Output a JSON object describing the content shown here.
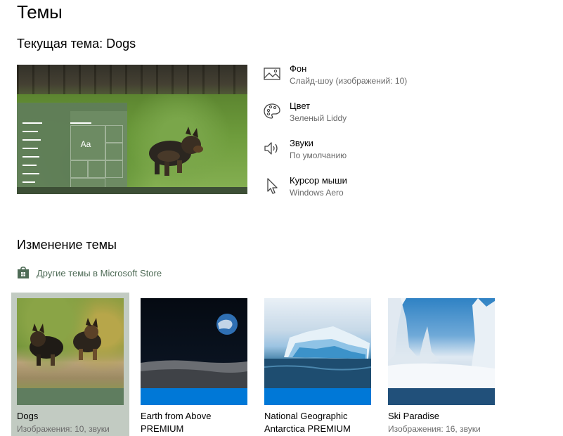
{
  "page": {
    "title": "Темы",
    "current_theme_label": "Текущая тема: Dogs"
  },
  "preview": {
    "sample_text": "Aa"
  },
  "properties": [
    {
      "title": "Фон",
      "subtitle": "Слайд-шоу (изображений: 10)",
      "icon": "picture-icon"
    },
    {
      "title": "Цвет",
      "subtitle": "Зеленый Liddy",
      "icon": "palette-icon"
    },
    {
      "title": "Звуки",
      "subtitle": "По умолчанию",
      "icon": "speaker-icon"
    },
    {
      "title": "Курсор мыши",
      "subtitle": "Windows Aero",
      "icon": "cursor-icon"
    }
  ],
  "change_section": {
    "title": "Изменение темы",
    "store_link": "Другие темы в Microsoft Store",
    "store_icon": "store-bag-icon"
  },
  "themes": [
    {
      "name": "Dogs",
      "subtitle": "Изображения: 10, звуки",
      "bar_color": "#5f7d5f",
      "selected": true
    },
    {
      "name": "Earth from Above PREMIUM",
      "subtitle": "",
      "bar_color": "#0078d7",
      "selected": false
    },
    {
      "name": "National Geographic Antarctica PREMIUM",
      "subtitle": "",
      "bar_color": "#0078d7",
      "selected": false
    },
    {
      "name": "Ski Paradise",
      "subtitle": "Изображения: 16, звуки",
      "bar_color": "#21507a",
      "selected": false
    }
  ],
  "colors": {
    "accent_green": "#5f7d5f",
    "link_green": "#4e6b56",
    "selection_bg": "#c2cbc2",
    "windows_blue": "#0078d7"
  }
}
